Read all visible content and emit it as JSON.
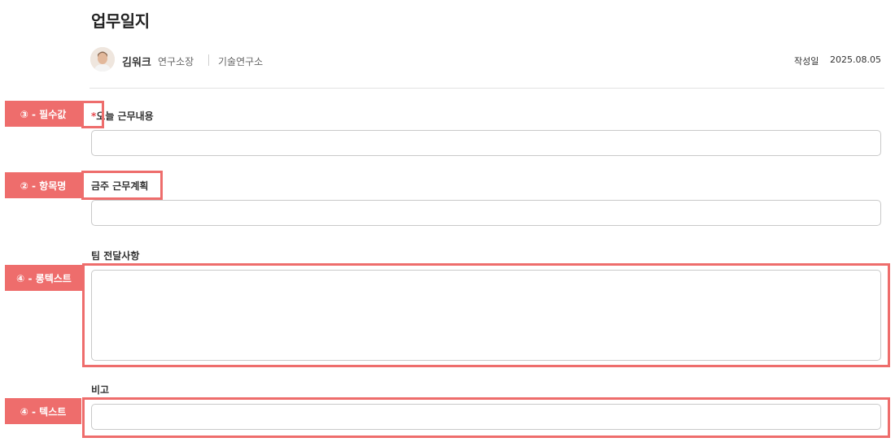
{
  "header": {
    "title": "업무일지",
    "author": {
      "name": "김워크",
      "role": "연구소장",
      "department": "기술연구소"
    },
    "date_label": "작성일",
    "date_value": "2025.08.05"
  },
  "form": {
    "required_mark": "*",
    "fields": [
      {
        "label": "오늘 근무내용",
        "required": true,
        "value": ""
      },
      {
        "label": "금주 근무계획",
        "required": false,
        "value": ""
      },
      {
        "label": "팀 전달사항",
        "required": false,
        "value": ""
      },
      {
        "label": "비고",
        "required": false,
        "value": ""
      }
    ]
  },
  "annotations": {
    "required": "③ - 필수값",
    "field_name": "② - 항목명",
    "long_text": "④ - 롱텍스트",
    "text": "④ - 텍스트"
  },
  "colors": {
    "annotation": "#ee6d6c",
    "required_star": "#e5484d"
  }
}
